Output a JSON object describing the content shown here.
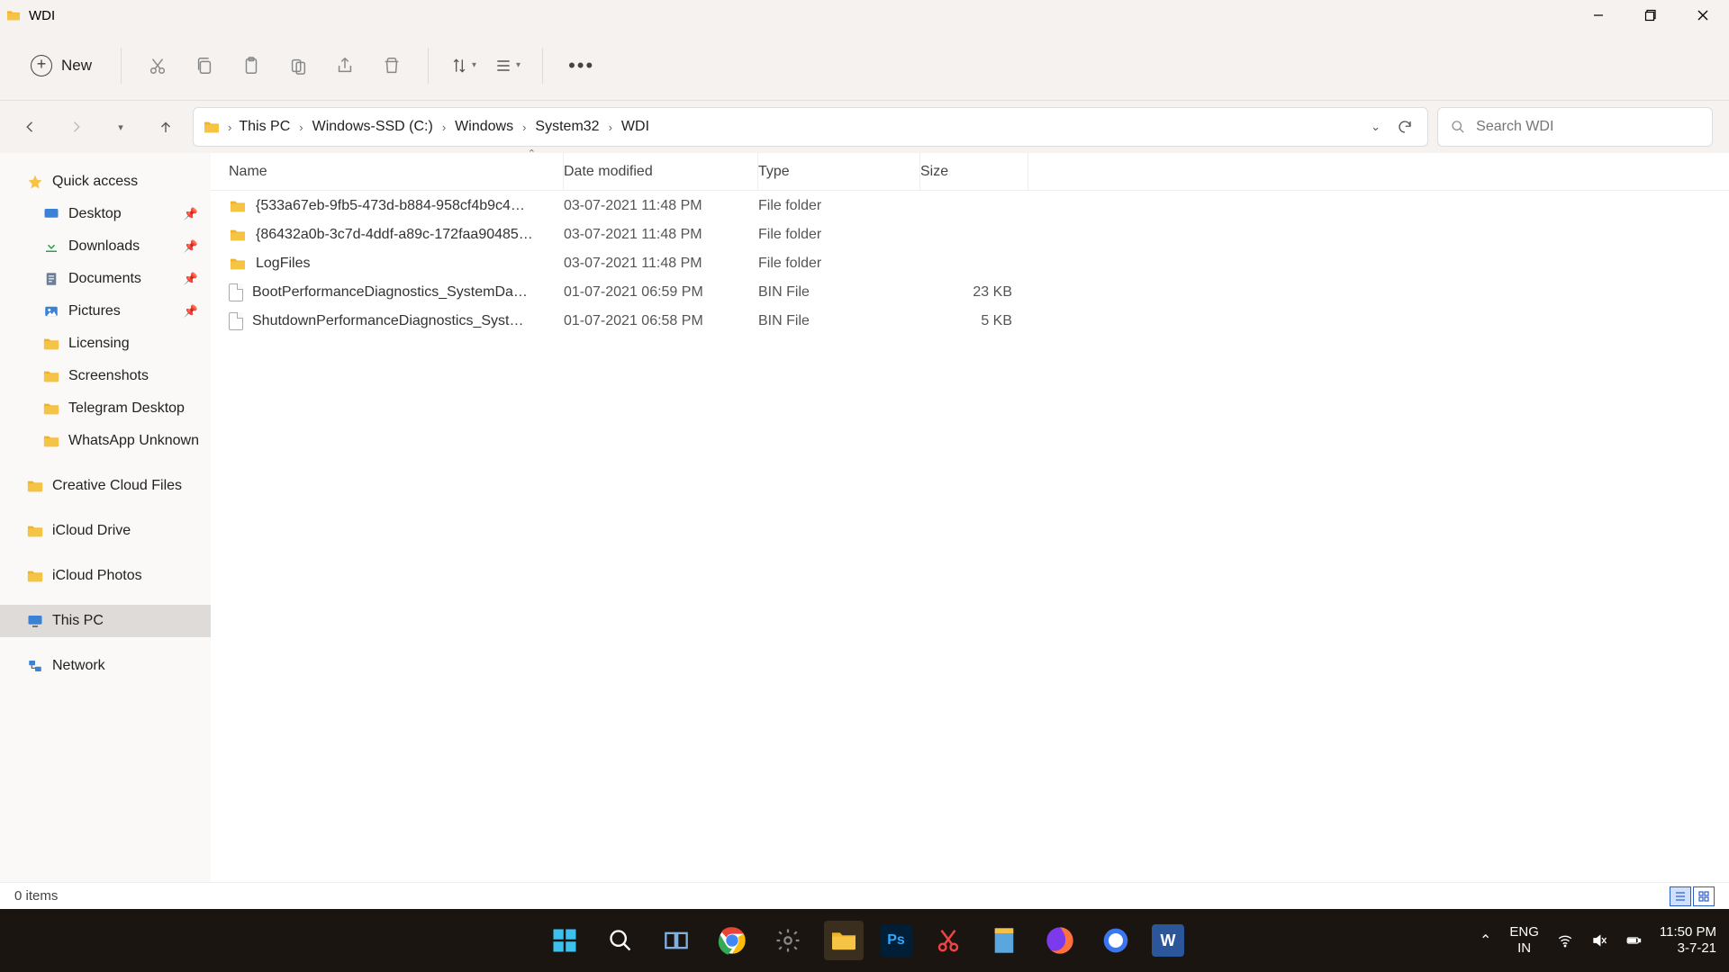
{
  "window": {
    "title": "WDI"
  },
  "toolbar": {
    "new_label": "New"
  },
  "breadcrumb": [
    "This PC",
    "Windows-SSD (C:)",
    "Windows",
    "System32",
    "WDI"
  ],
  "search": {
    "placeholder": "Search WDI"
  },
  "sidebar": {
    "quick_access": "Quick access",
    "pinned": [
      {
        "label": "Desktop",
        "icon": "desktop"
      },
      {
        "label": "Downloads",
        "icon": "downloads"
      },
      {
        "label": "Documents",
        "icon": "documents"
      },
      {
        "label": "Pictures",
        "icon": "pictures"
      }
    ],
    "folders": [
      "Licensing",
      "Screenshots",
      "Telegram Desktop",
      "WhatsApp Unknown"
    ],
    "roots": [
      {
        "label": "Creative Cloud Files",
        "icon": "cc"
      },
      {
        "label": "iCloud Drive",
        "icon": "icloud"
      },
      {
        "label": "iCloud Photos",
        "icon": "icloud"
      },
      {
        "label": "This PC",
        "icon": "pc",
        "selected": true
      },
      {
        "label": "Network",
        "icon": "net"
      }
    ]
  },
  "columns": {
    "name": "Name",
    "date": "Date modified",
    "type": "Type",
    "size": "Size"
  },
  "files": [
    {
      "name": "{533a67eb-9fb5-473d-b884-958cf4b9c4…",
      "date": "03-07-2021 11:48 PM",
      "type": "File folder",
      "size": "",
      "kind": "folder"
    },
    {
      "name": "{86432a0b-3c7d-4ddf-a89c-172faa90485…",
      "date": "03-07-2021 11:48 PM",
      "type": "File folder",
      "size": "",
      "kind": "folder"
    },
    {
      "name": "LogFiles",
      "date": "03-07-2021 11:48 PM",
      "type": "File folder",
      "size": "",
      "kind": "folder"
    },
    {
      "name": "BootPerformanceDiagnostics_SystemDa…",
      "date": "01-07-2021 06:59 PM",
      "type": "BIN File",
      "size": "23 KB",
      "kind": "file"
    },
    {
      "name": "ShutdownPerformanceDiagnostics_Syst…",
      "date": "01-07-2021 06:58 PM",
      "type": "BIN File",
      "size": "5 KB",
      "kind": "file"
    }
  ],
  "status": {
    "text": "0 items"
  },
  "taskbar": {
    "lang1": "ENG",
    "lang2": "IN",
    "time": "11:50 PM",
    "date": "3-7-21",
    "apps": [
      "start",
      "search",
      "taskview",
      "chrome",
      "settings",
      "explorer",
      "ps",
      "snip",
      "notes",
      "firefox",
      "signal",
      "word"
    ]
  },
  "colors": {
    "highlight": "#e11",
    "accent": "#2a5fc9"
  }
}
